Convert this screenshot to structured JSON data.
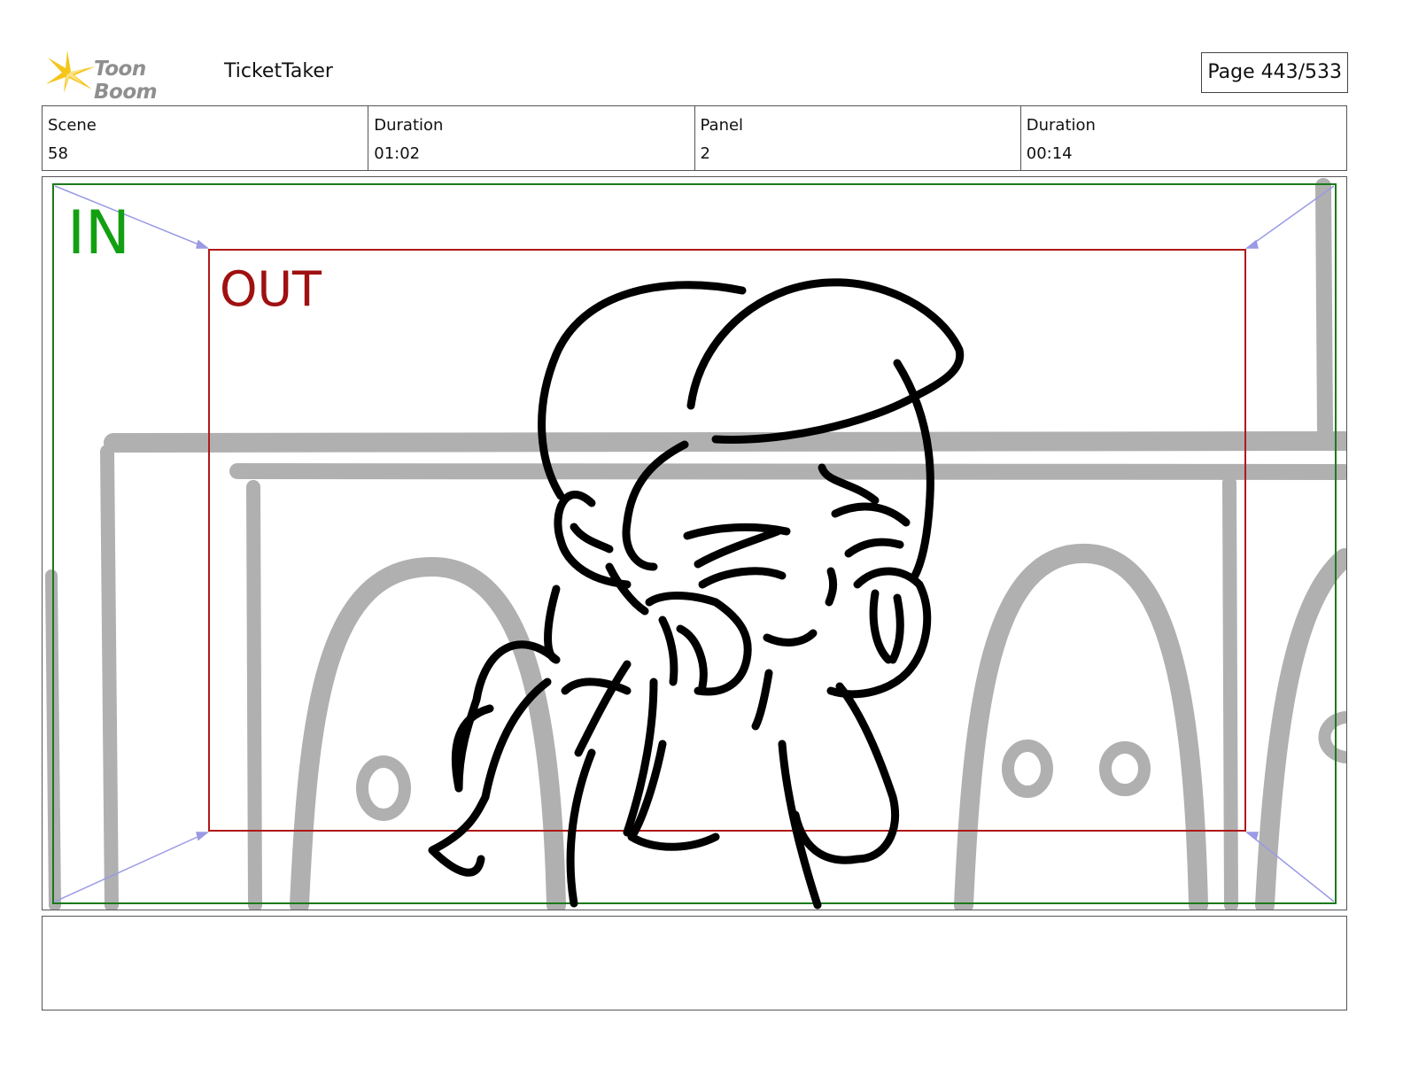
{
  "header": {
    "logo_text": "Toon Boom",
    "project_title": "TicketTaker",
    "page_label": "Page 443/533"
  },
  "info": [
    {
      "label": "Scene",
      "value": "58"
    },
    {
      "label": "Duration",
      "value": "01:02"
    },
    {
      "label": "Panel",
      "value": "2"
    },
    {
      "label": "Duration",
      "value": "00:14"
    }
  ],
  "panel": {
    "in_label": "IN",
    "out_label": "OUT"
  },
  "notes": {
    "text": ""
  },
  "colors": {
    "in_frame": "#1a7a1a",
    "out_frame": "#b01818",
    "guide_arrows": "#9a9ae6",
    "background_sketch": "#b0b0b0",
    "character_lines": "#000000"
  }
}
